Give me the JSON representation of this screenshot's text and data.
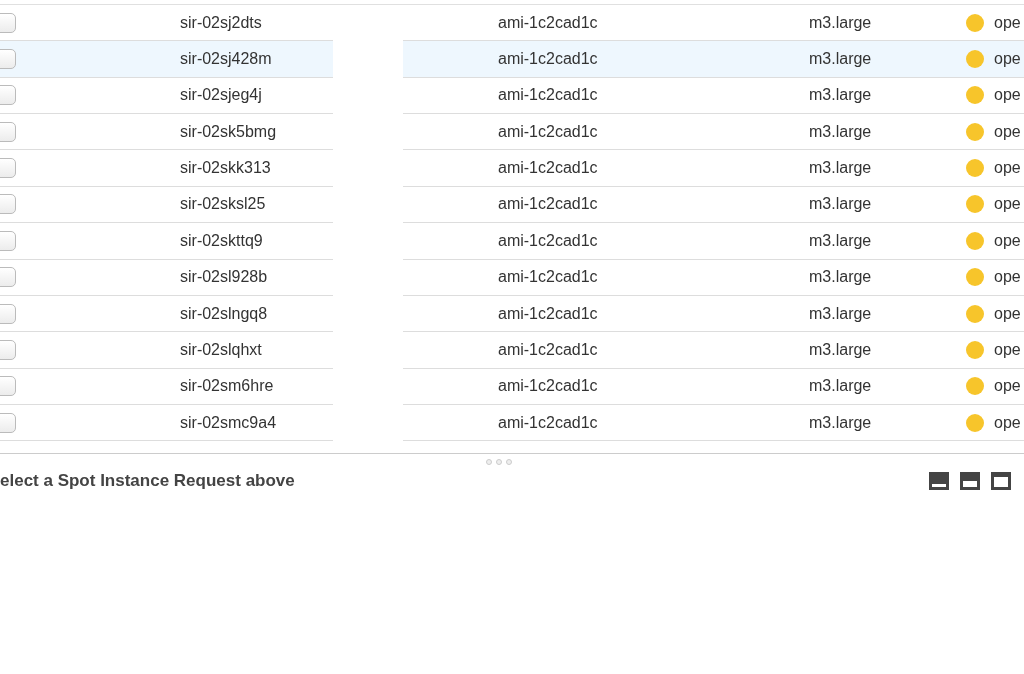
{
  "rows": [
    {
      "checked": false,
      "highlighted": false,
      "id": "sir-02sj2dts",
      "ami": "ami-1c2cad1c",
      "type": "m3.large",
      "color": "#f7c52b",
      "status": "ope"
    },
    {
      "checked": false,
      "highlighted": true,
      "id": "sir-02sj428m",
      "ami": "ami-1c2cad1c",
      "type": "m3.large",
      "color": "#f7c52b",
      "status": "ope"
    },
    {
      "checked": false,
      "highlighted": false,
      "id": "sir-02sjeg4j",
      "ami": "ami-1c2cad1c",
      "type": "m3.large",
      "color": "#f7c52b",
      "status": "ope"
    },
    {
      "checked": false,
      "highlighted": false,
      "id": "sir-02sk5bmg",
      "ami": "ami-1c2cad1c",
      "type": "m3.large",
      "color": "#f7c52b",
      "status": "ope"
    },
    {
      "checked": false,
      "highlighted": false,
      "id": "sir-02skk313",
      "ami": "ami-1c2cad1c",
      "type": "m3.large",
      "color": "#f7c52b",
      "status": "ope"
    },
    {
      "checked": false,
      "highlighted": false,
      "id": "sir-02sksl25",
      "ami": "ami-1c2cad1c",
      "type": "m3.large",
      "color": "#f7c52b",
      "status": "ope"
    },
    {
      "checked": false,
      "highlighted": false,
      "id": "sir-02skttq9",
      "ami": "ami-1c2cad1c",
      "type": "m3.large",
      "color": "#f7c52b",
      "status": "ope"
    },
    {
      "checked": false,
      "highlighted": false,
      "id": "sir-02sl928b",
      "ami": "ami-1c2cad1c",
      "type": "m3.large",
      "color": "#f7c52b",
      "status": "ope"
    },
    {
      "checked": false,
      "highlighted": false,
      "id": "sir-02slngq8",
      "ami": "ami-1c2cad1c",
      "type": "m3.large",
      "color": "#f7c52b",
      "status": "ope"
    },
    {
      "checked": false,
      "highlighted": false,
      "id": "sir-02slqhxt",
      "ami": "ami-1c2cad1c",
      "type": "m3.large",
      "color": "#f7c52b",
      "status": "ope"
    },
    {
      "checked": false,
      "highlighted": false,
      "id": "sir-02sm6hre",
      "ami": "ami-1c2cad1c",
      "type": "m3.large",
      "color": "#f7c52b",
      "status": "ope"
    },
    {
      "checked": false,
      "highlighted": false,
      "id": "sir-02smc9a4",
      "ami": "ami-1c2cad1c",
      "type": "m3.large",
      "color": "#f7c52b",
      "status": "ope"
    }
  ],
  "details": {
    "message": "elect a Spot Instance Request above"
  }
}
